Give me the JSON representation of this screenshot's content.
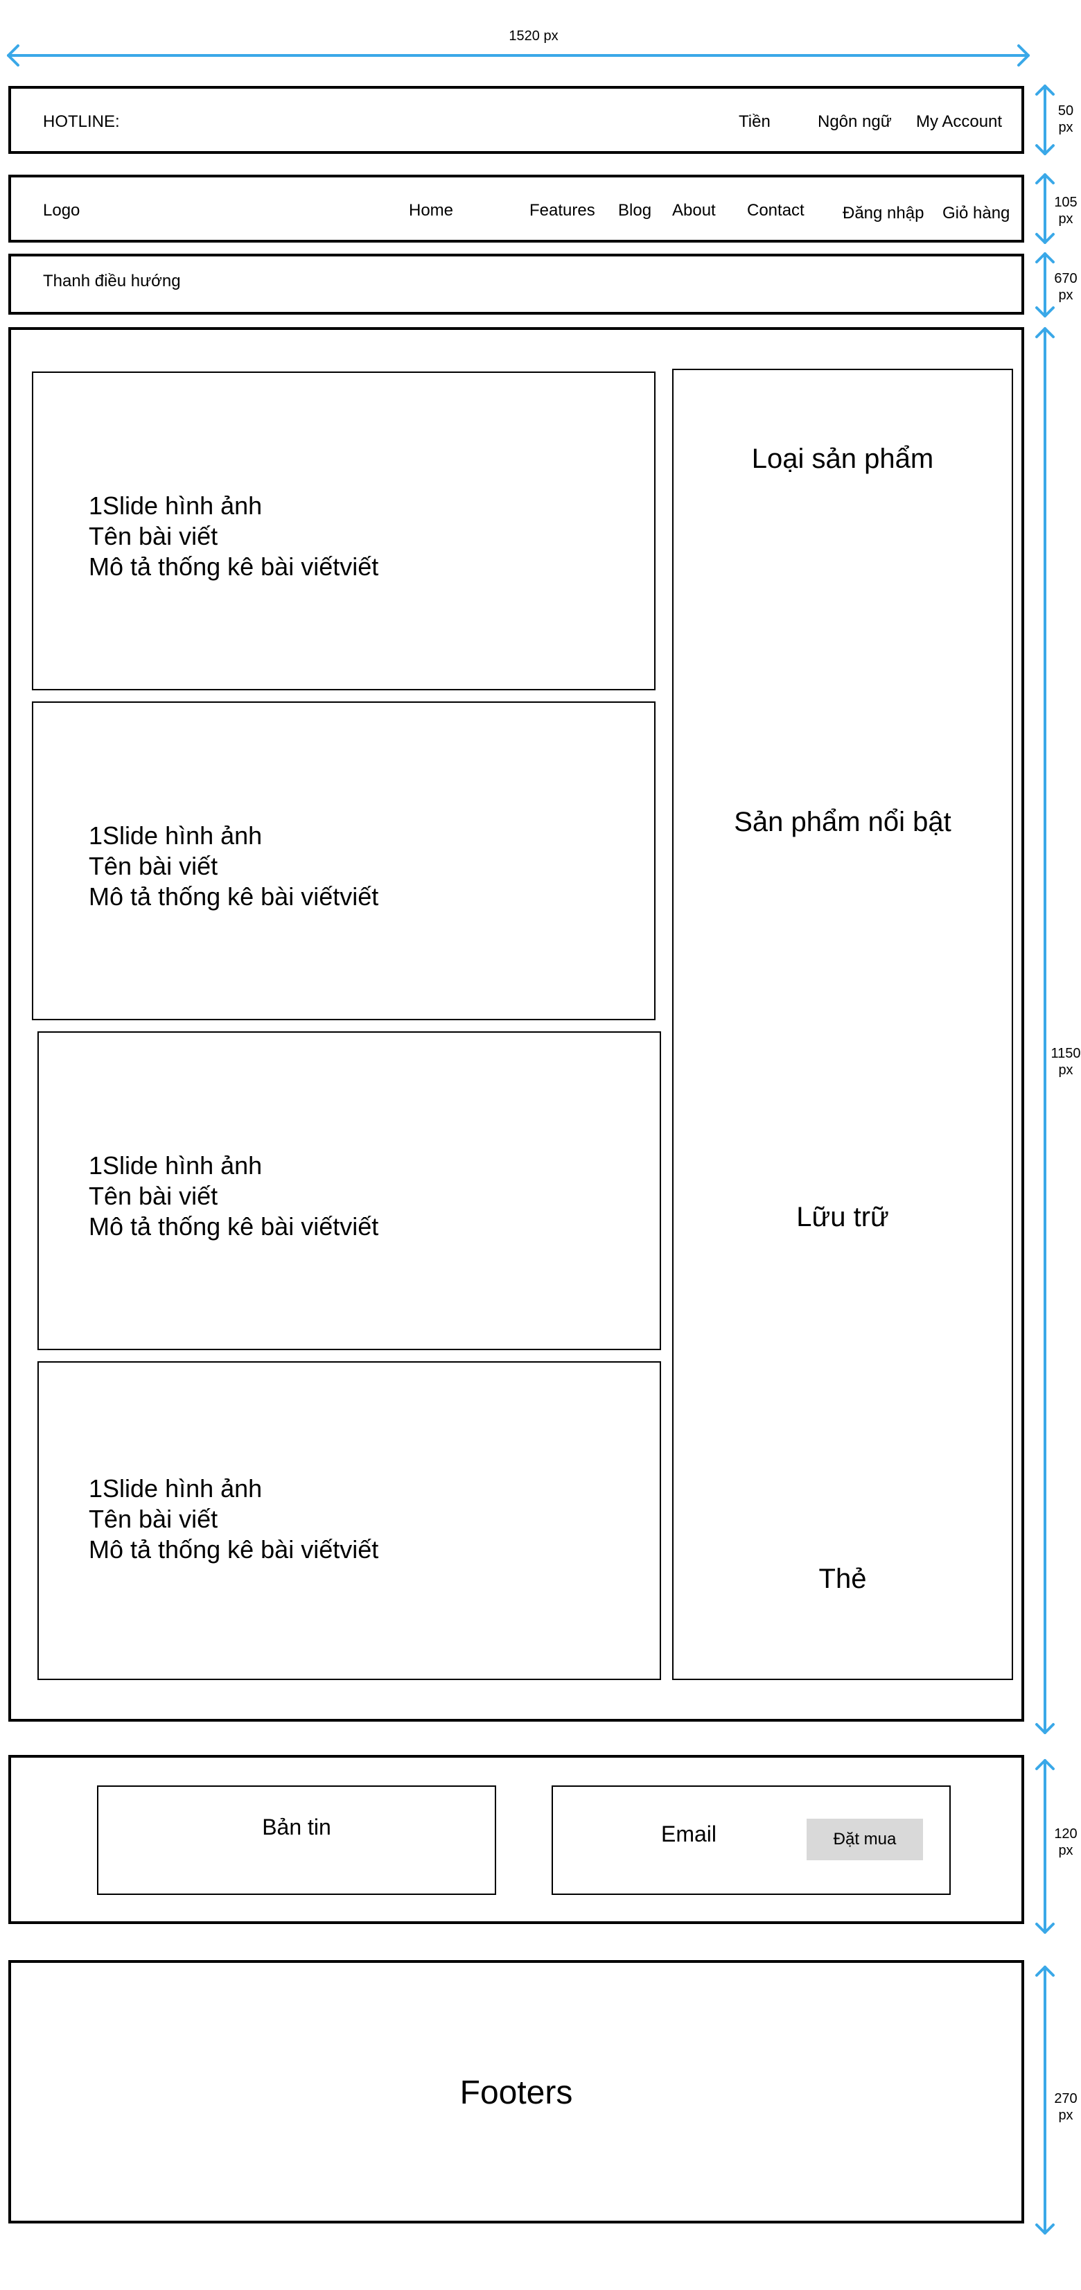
{
  "dimensions": {
    "width": "1520 px",
    "topbar_height": "50\npx",
    "header_height": "105\npx",
    "nav_height": "670\npx",
    "content_height": "1150\npx",
    "newsletter_height": "120\npx",
    "footer_height": "270\npx",
    "arrow_color": "#3aa8e8"
  },
  "topbar": {
    "hotline": "HOTLINE:",
    "currency": "Tiền",
    "language": "Ngôn ngữ",
    "account": "My Account"
  },
  "header": {
    "logo": "Logo",
    "menu": [
      "Home",
      "Features",
      "Blog",
      "About",
      "Contact"
    ],
    "login": "Đăng nhập",
    "cart": "Giỏ hàng"
  },
  "navbar": {
    "label": "Thanh  điều hướng"
  },
  "slides": [
    {
      "image": "1Slide hình ảnh",
      "title": "Tên bài viết",
      "desc": "Mô tả thống kê bài viếtviết"
    },
    {
      "image": "1Slide hình ảnh",
      "title": "Tên bài viết",
      "desc": "Mô tả thống kê bài viếtviết"
    },
    {
      "image": "1Slide hình ảnh",
      "title": "Tên bài viết",
      "desc": "Mô tả thống kê bài viếtviết"
    },
    {
      "image": "1Slide hình ảnh",
      "title": "Tên bài viết",
      "desc": "Mô tả thống kê bài viếtviết"
    }
  ],
  "sidebar": {
    "categories": "Loại sản phẩm",
    "featured": "Sản phẩm nổi bật",
    "archive": "Lữu trữ",
    "tags": "Thẻ"
  },
  "newsletter": {
    "label": "Bản tin",
    "email": "Email",
    "button": "Đặt mua"
  },
  "footer": {
    "label": "Footers"
  }
}
